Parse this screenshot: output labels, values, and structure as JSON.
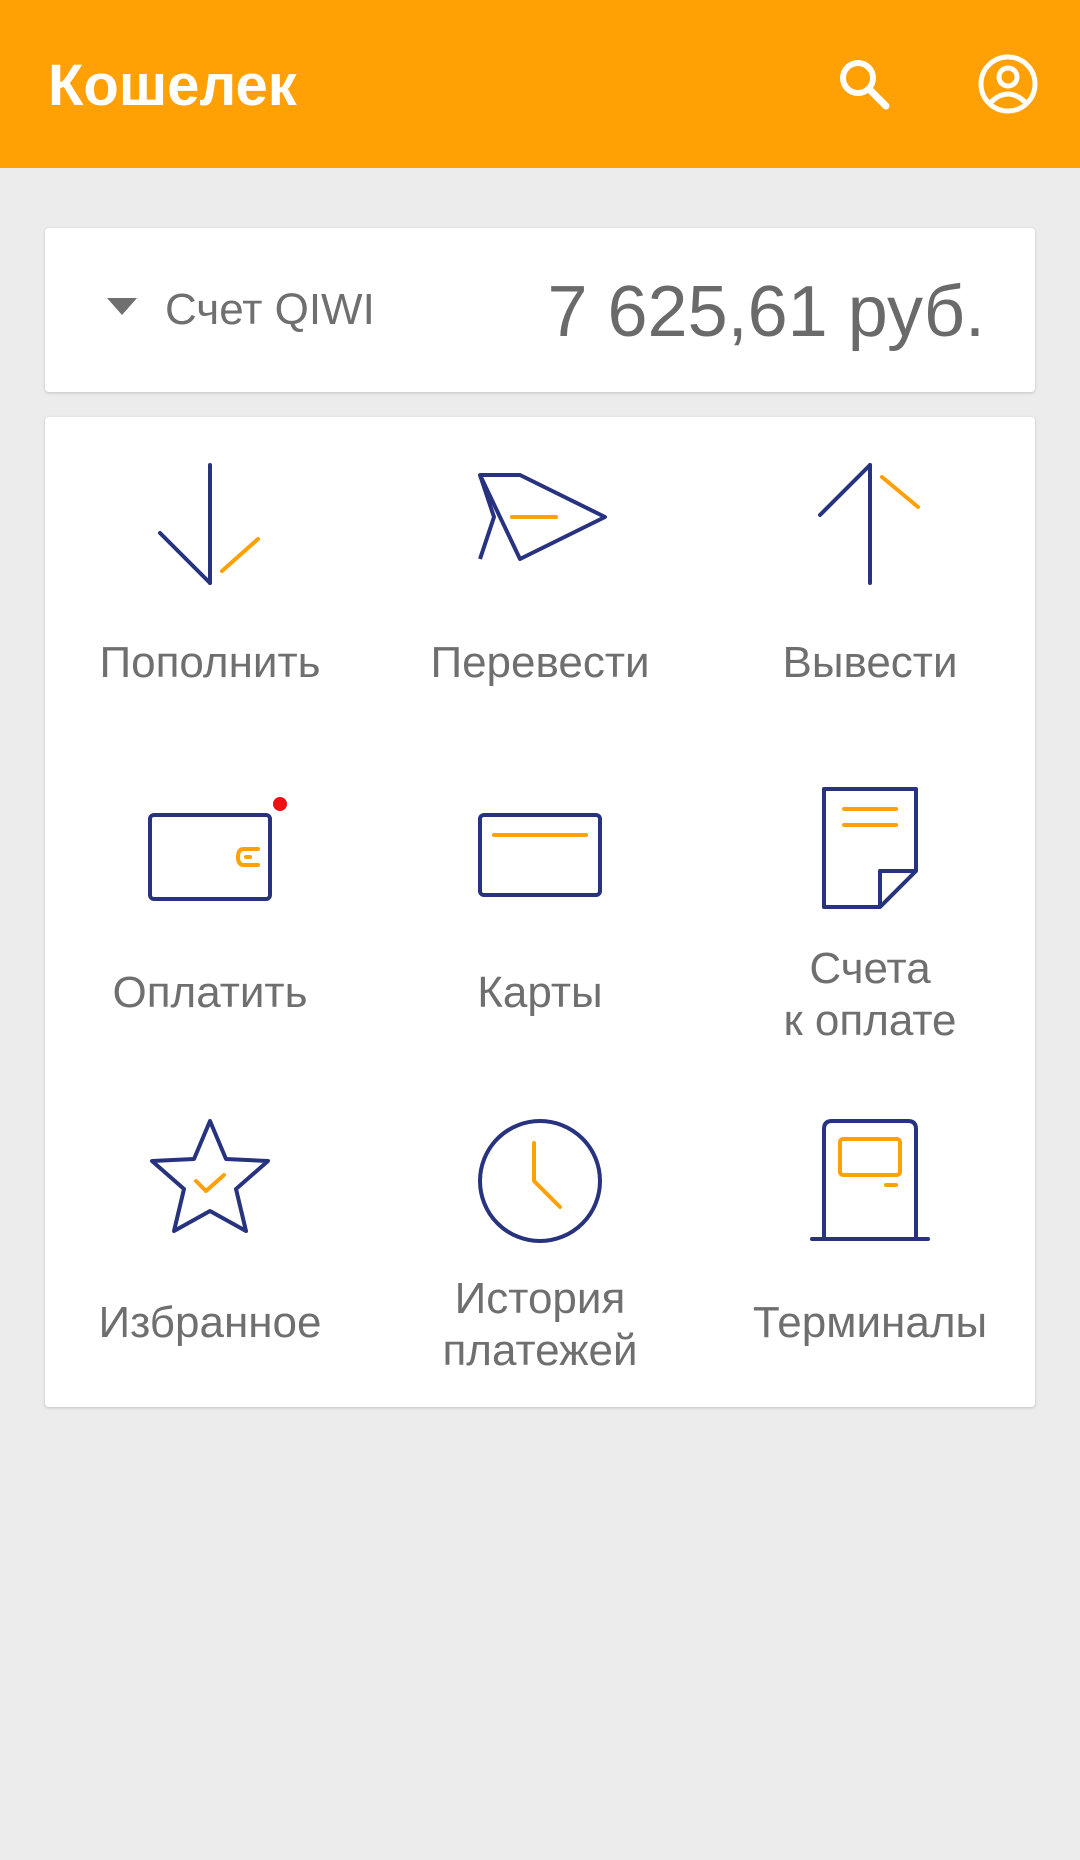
{
  "appbar": {
    "title": "Кошелек",
    "search_icon": "search-icon",
    "profile_icon": "account-circle-icon",
    "background": "#ffa004"
  },
  "account": {
    "name": "Счет QIWI",
    "balance": "7 625,61 руб.",
    "dropdown_icon": "arrow-drop-down-icon"
  },
  "actions": [
    {
      "label": "Пополнить",
      "icon": "arrow-down-icon"
    },
    {
      "label": "Перевести",
      "icon": "paper-plane-icon"
    },
    {
      "label": "Вывести",
      "icon": "arrow-up-icon"
    },
    {
      "label": "Оплатить",
      "icon": "wallet-icon",
      "notification": true
    },
    {
      "label": "Карты",
      "icon": "card-icon"
    },
    {
      "label": "Счета\nк оплате",
      "icon": "invoice-icon"
    },
    {
      "label": "Избранное",
      "icon": "star-icon"
    },
    {
      "label": "История\nплатежей",
      "icon": "clock-icon"
    },
    {
      "label": "Терминалы",
      "icon": "terminal-icon"
    }
  ],
  "colors": {
    "icon_primary": "#27337f",
    "icon_accent": "#ffa004",
    "notification": "#ee1111",
    "text_secondary": "#6f6f6f"
  }
}
